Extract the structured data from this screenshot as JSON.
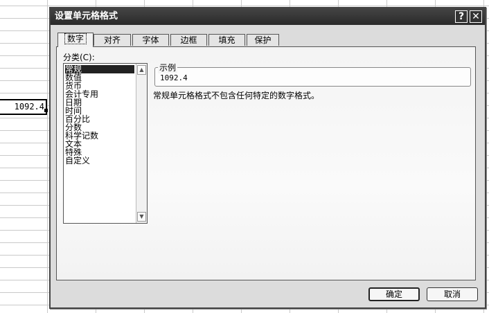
{
  "spreadsheet": {
    "cell_value": "1092.4"
  },
  "dialog": {
    "title": "设置单元格格式",
    "help_label": "?",
    "close_label": "✕",
    "tabs": [
      {
        "label": "数字",
        "active": true
      },
      {
        "label": "对齐",
        "active": false
      },
      {
        "label": "字体",
        "active": false
      },
      {
        "label": "边框",
        "active": false
      },
      {
        "label": "填充",
        "active": false
      },
      {
        "label": "保护",
        "active": false
      }
    ],
    "category_label": "分类(C):",
    "categories": [
      {
        "label": "常规",
        "selected": true
      },
      {
        "label": "数值",
        "selected": false
      },
      {
        "label": "货币",
        "selected": false
      },
      {
        "label": "会计专用",
        "selected": false
      },
      {
        "label": "日期",
        "selected": false
      },
      {
        "label": "时间",
        "selected": false
      },
      {
        "label": "百分比",
        "selected": false
      },
      {
        "label": "分数",
        "selected": false
      },
      {
        "label": "科学记数",
        "selected": false
      },
      {
        "label": "文本",
        "selected": false
      },
      {
        "label": "特殊",
        "selected": false
      },
      {
        "label": "自定义",
        "selected": false
      }
    ],
    "sample_label": "示例",
    "sample_value": "1092.4",
    "description": "常规单元格格式不包含任何特定的数字格式。",
    "ok_label": "确定",
    "cancel_label": "取消"
  }
}
